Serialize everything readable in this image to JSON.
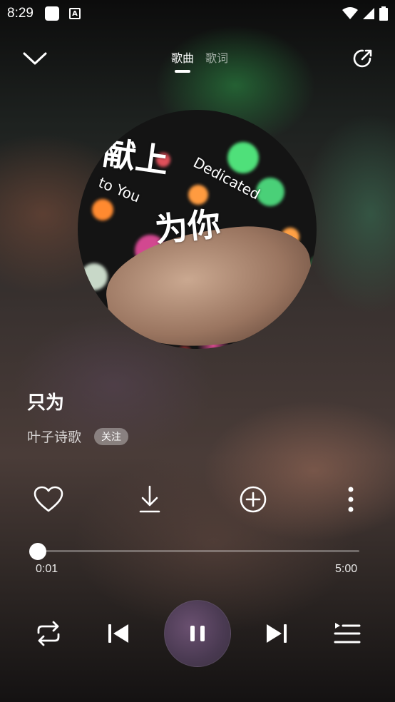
{
  "status_bar": {
    "time": "8:29"
  },
  "header": {
    "tabs": [
      {
        "label": "歌曲",
        "active": true
      },
      {
        "label": "歌词",
        "active": false
      }
    ]
  },
  "album_art": {
    "title_zh_1": "献上",
    "title_zh_2": "为你",
    "title_en_1": "Dedicated",
    "title_en_2": "to You"
  },
  "song": {
    "title": "只为",
    "artist": "叶子诗歌",
    "follow_label": "关注"
  },
  "actions": [
    "heart-icon",
    "download-icon",
    "add-circle-icon",
    "more-vertical-icon"
  ],
  "playback": {
    "current_time": "0:01",
    "total_time": "5:00",
    "progress_fraction": 0.003,
    "state": "playing"
  },
  "colors": {
    "accent": "#ffffff",
    "play_button": "#4a3a52"
  }
}
